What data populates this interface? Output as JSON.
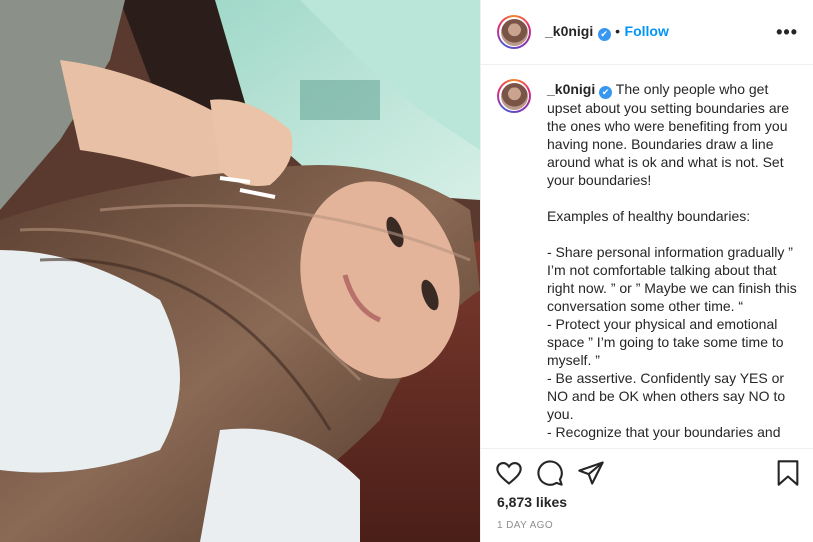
{
  "post": {
    "username": "_k0nigi",
    "verified_symbol": "✔",
    "separator": "•",
    "follow_label": "Follow",
    "more_label": "•••",
    "caption": "The only people who get upset about you setting boundaries are the ones who were benefiting from you having none. Boundaries draw a line around what is ok and what is not. Set your boundaries!\n\nExamples of healthy boundaries:\n\n- Share personal information gradually ” I’m not comfortable talking about that right now. ” or ” Maybe we can finish this conversation some other time. “\n- Protect your physical and emotional space ” I’m going to take some time to myself. ”\n- Be assertive. Confidently say YES or NO and be OK when others say NO to you.\n- Recognize that your boundaries and",
    "likes": "6,873 likes",
    "timestamp": "1 DAY AGO"
  },
  "icons": {
    "like": "heart-icon",
    "comment": "comment-icon",
    "share": "share-icon",
    "save": "bookmark-icon",
    "verified": "verified-badge-icon"
  },
  "colors": {
    "accent": "#0095f6",
    "verified": "#3897f0",
    "text": "#262626",
    "muted": "#8e8e8e"
  }
}
